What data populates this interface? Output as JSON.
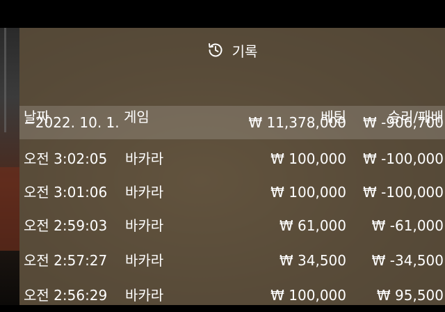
{
  "header": {
    "title": "기록",
    "icon": "history-icon"
  },
  "columns": {
    "date": "날짜",
    "game": "게임",
    "bet": "베팅",
    "result": "승리/패배"
  },
  "summary": {
    "date": "−2022. 10. 1.",
    "game": "",
    "bet": "₩ 11,378,000",
    "result": "₩ -906,700"
  },
  "rows": [
    {
      "date": "오전 3:02:05",
      "game": "바카라",
      "bet": "₩ 100,000",
      "result": "₩ -100,000"
    },
    {
      "date": "오전 3:01:06",
      "game": "바카라",
      "bet": "₩ 100,000",
      "result": "₩ -100,000"
    },
    {
      "date": "오전 2:59:03",
      "game": "바카라",
      "bet": "₩ 61,000",
      "result": "₩ -61,000"
    },
    {
      "date": "오전 2:57:27",
      "game": "바카라",
      "bet": "₩ 34,500",
      "result": "₩ -34,500"
    },
    {
      "date": "오전 2:56:29",
      "game": "바카라",
      "bet": "₩ 100,000",
      "result": "₩ 95,500"
    }
  ]
}
